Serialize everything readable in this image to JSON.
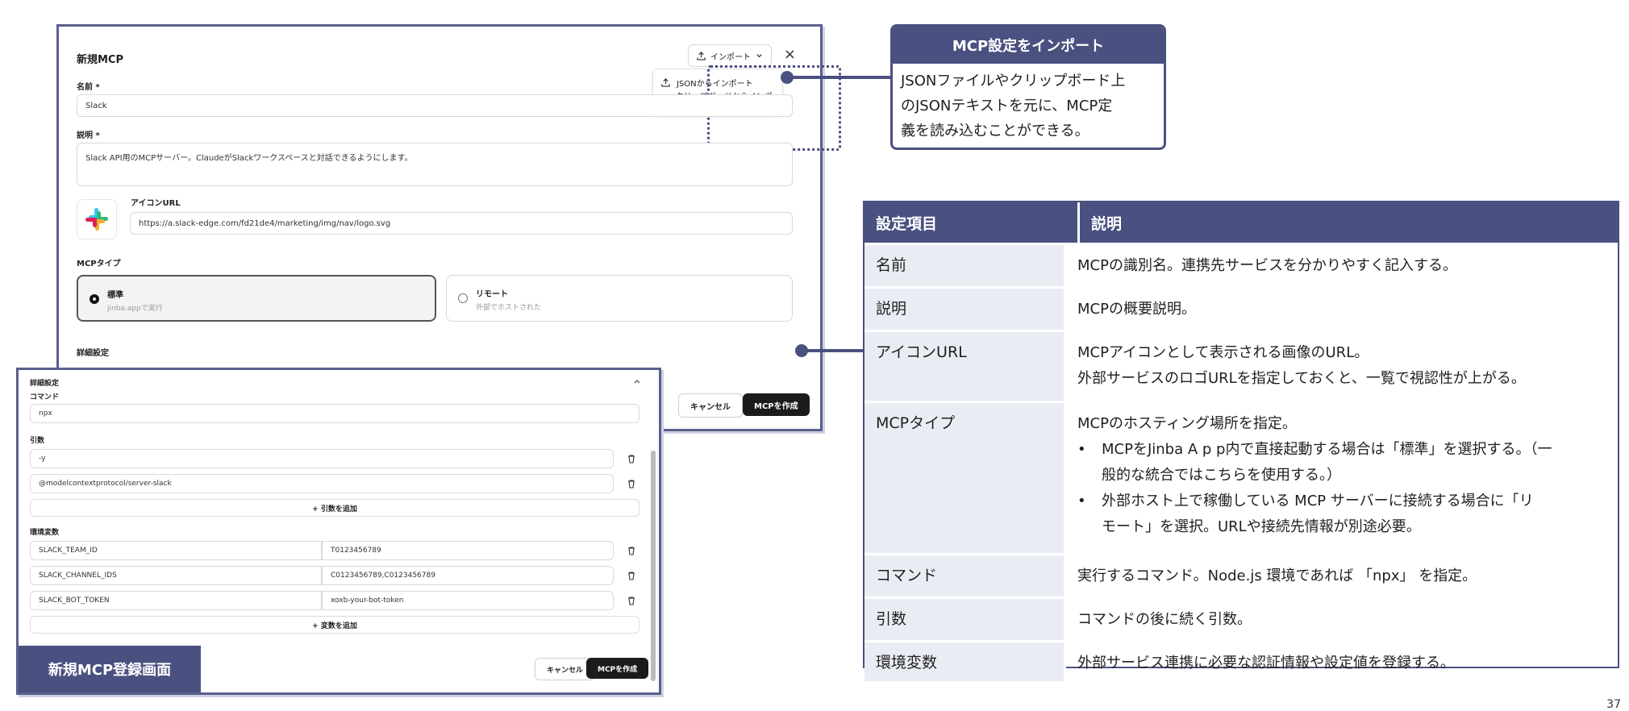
{
  "dialog": {
    "title": "新規MCP",
    "name_label": "名前 *",
    "name_value": "Slack",
    "desc_label": "説明 *",
    "desc_value": "Slack API用のMCPサーバー。ClaudeがSlackワークスペースと対話できるようにします。",
    "icon_label": "アイコンURL",
    "icon_url": "https://a.slack-edge.com/fd21de4/marketing/img/nav/logo.svg",
    "type_label": "MCPタイプ",
    "type_options": [
      {
        "label": "標準",
        "sub": "jinba.appで実行",
        "selected": true
      },
      {
        "label": "リモート",
        "sub": "外部でホストされた",
        "selected": false
      }
    ],
    "advanced_label": "詳細設定",
    "import_button": "インポート",
    "import_menu": [
      "JSONからインポート",
      "クリップボードからインポート"
    ],
    "cancel": "キャンセル",
    "create": "MCPを作成"
  },
  "advanced": {
    "title": "詳細設定",
    "command_label": "コマンド",
    "command_value": "npx",
    "args_label": "引数",
    "args": [
      "-y",
      "@modelcontextprotocol/server-slack"
    ],
    "add_arg": "+ 引数を追加",
    "env_label": "環境変数",
    "env": [
      {
        "key": "SLACK_TEAM_ID",
        "value": "T0123456789"
      },
      {
        "key": "SLACK_CHANNEL_IDS",
        "value": "C0123456789,C0123456789"
      },
      {
        "key": "SLACK_BOT_TOKEN",
        "value": "xoxb-your-bot-token"
      }
    ],
    "add_env": "+ 変数を追加",
    "cancel": "キャンセル",
    "create": "MCPを作成",
    "caption": "新規MCP登録画面"
  },
  "callout": {
    "title": "MCP設定をインポート",
    "lines": [
      "JSONファイルやクリップボード上",
      "のJSONテキストを元に、MCP定",
      "義を読み込むことができる。"
    ]
  },
  "table": {
    "headers": [
      "設定項目",
      "説明"
    ],
    "rows": [
      {
        "item": "名前",
        "desc": [
          "MCPの識別名。連携先サービスを分かりやすく記入する。"
        ]
      },
      {
        "item": "説明",
        "desc": [
          "MCPの概要説明。"
        ]
      },
      {
        "item": "アイコンURL",
        "desc": [
          "MCPアイコンとして表示される画像のURL。",
          "外部サービスのロゴURLを指定しておくと、一覧で視認性が上がる。"
        ]
      },
      {
        "item": "MCPタイプ",
        "desc": [
          "MCPのホスティング場所を指定。"
        ],
        "bullets": [
          [
            "MCPをJinba A p p内で直接起動する場合は「標準」を選択する。（一",
            "般的な統合ではこちらを使用する。）"
          ],
          [
            "外部ホスト上で稼働している MCP サーバーに接続する場合に「リ",
            "モート」を選択。URLや接続先情報が別途必要。"
          ]
        ]
      },
      {
        "item": "コマンド",
        "desc": [
          "実行するコマンド。Node.js 環境であれば 「npx」 を指定。"
        ]
      },
      {
        "item": "引数",
        "desc": [
          "コマンドの後に続く引数。"
        ]
      },
      {
        "item": "環境変数",
        "desc": [
          "外部サービス連携に必要な認証情報や設定値を登録する。"
        ]
      }
    ],
    "bullet_char": "•"
  },
  "page_number": "37",
  "colors": {
    "accent": "#4a5080",
    "row_bg": "#eaecf4",
    "button_dark": "#1b1b1b"
  }
}
